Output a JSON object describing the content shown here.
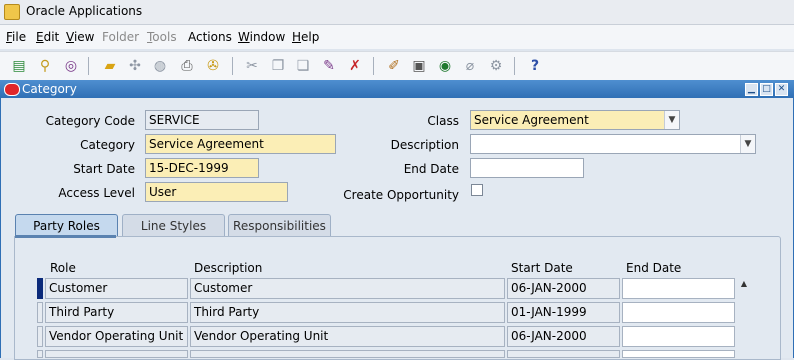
{
  "window": {
    "title": "Oracle Applications"
  },
  "menu": [
    {
      "label": "File",
      "u": "F",
      "rest": "ile",
      "disabled": false
    },
    {
      "label": "Edit",
      "u": "E",
      "rest": "dit",
      "disabled": false
    },
    {
      "label": "View",
      "u": "V",
      "rest": "iew",
      "disabled": false
    },
    {
      "label": "Folder",
      "u": "",
      "rest": "Folder",
      "disabled": true
    },
    {
      "label": "Tools",
      "u": "T",
      "rest": "ools",
      "disabled": true
    },
    {
      "label": "Actions",
      "u": "",
      "rest": "Actions",
      "disabled": false
    },
    {
      "label": "Window",
      "u": "W",
      "rest": "indow",
      "disabled": false
    },
    {
      "label": "Help",
      "u": "H",
      "rest": "elp",
      "disabled": false
    }
  ],
  "toolbar": {
    "icons": [
      "new-icon",
      "find-icon",
      "navigator-icon",
      "save-icon",
      "nextstep-icon",
      "switch-responsibility-icon",
      "print-icon",
      "close-form-icon",
      "cut-icon",
      "copy-icon",
      "paste-icon",
      "new-record-icon",
      "delete-record-icon",
      "edit-field-icon",
      "zoom-icon",
      "translations-icon",
      "attachments-icon",
      "folder-tools-icon",
      "help-icon"
    ]
  },
  "form_window": {
    "title": "Category"
  },
  "form": {
    "category_code_label": "Category Code",
    "category_code": "SERVICE",
    "category_label": "Category",
    "category": "Service Agreement",
    "start_date_label": "Start Date",
    "start_date": "15-DEC-1999",
    "access_level_label": "Access Level",
    "access_level": "User",
    "class_label": "Class",
    "class": "Service Agreement",
    "description_label": "Description",
    "description": "",
    "end_date_label": "End Date",
    "end_date": "",
    "create_opportunity_label": "Create Opportunity",
    "create_opportunity": false
  },
  "tabs": [
    {
      "label": "Party Roles",
      "active": true
    },
    {
      "label": "Line Styles",
      "active": false
    },
    {
      "label": "Responsibilities",
      "active": false
    }
  ],
  "table": {
    "headers": {
      "role": "Role",
      "description": "Description",
      "start_date": "Start Date",
      "end_date": "End Date"
    },
    "rows": [
      {
        "role": "Customer",
        "description": "Customer",
        "start_date": "06-JAN-2000",
        "end_date": ""
      },
      {
        "role": "Third Party",
        "description": "Third Party",
        "start_date": "01-JAN-1999",
        "end_date": ""
      },
      {
        "role": "Vendor Operating Unit",
        "description": "Vendor Operating Unit",
        "start_date": "06-JAN-2000",
        "end_date": ""
      },
      {
        "role": "",
        "description": "",
        "start_date": "",
        "end_date": ""
      }
    ]
  }
}
